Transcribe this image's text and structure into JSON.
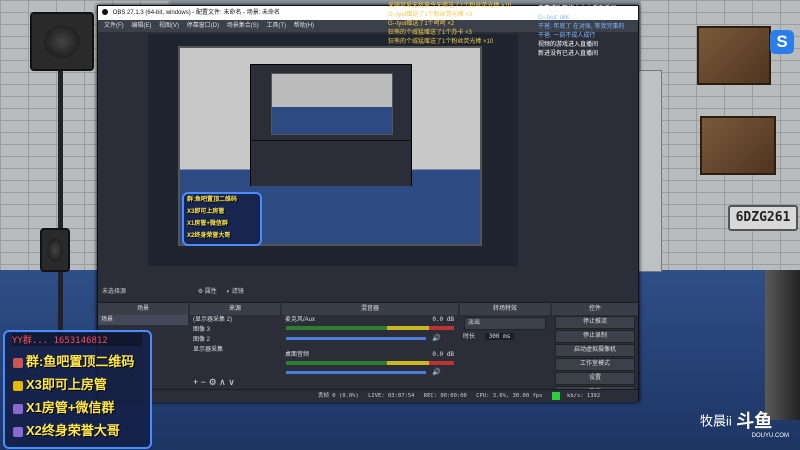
{
  "obs": {
    "title": "OBS 27.1.3 (64-bit, windows) - 配置文件: 未命名 - 场景: 未命名",
    "menu": [
      "文件(F)",
      "编辑(E)",
      "视图(V)",
      "停靠窗口(D)",
      "场景集合(S)",
      "工具(T)",
      "帮助(H)"
    ],
    "preview_label": "未选择源",
    "toolbar": {
      "properties": "属性",
      "filters": "滤镜"
    },
    "docks": {
      "scenes": {
        "title": "场景",
        "items": [
          "场景"
        ]
      },
      "sources": {
        "title": "来源",
        "items": [
          "(显示器采集 2)",
          "图像 3",
          "图像 2",
          "显示器采集"
        ]
      },
      "mixer": {
        "title": "混音器",
        "channels": [
          {
            "name": "麦克风/Aux",
            "level": "0.0 dB"
          },
          {
            "name": "桌面音频",
            "level": "0.0 dB"
          }
        ],
        "ticks": [
          "-60",
          "-55",
          "-50",
          "-45",
          "-40",
          "-35",
          "-30",
          "-25",
          "-20",
          "-15",
          "-10",
          "-5",
          "0"
        ]
      },
      "transitions": {
        "title": "转场特效",
        "type": "淡出",
        "duration_label": "时长",
        "duration_value": "300 ms"
      },
      "controls": {
        "title": "控件",
        "buttons": [
          "停止推流",
          "停止录制",
          "启动虚拟摄像机",
          "工作室模式",
          "设置",
          "退出"
        ]
      }
    },
    "status": {
      "dropped": "丢帧 0 (0.0%)",
      "live": "LIVE: 03:07:54",
      "rec": "REC: 00:00:00",
      "cpu": "CPU: 3.6%, 30.00 fps",
      "bitrate": "kb/s: 1392"
    }
  },
  "chat_left": [
    {
      "text": "呆萌可爱无敌黄今天赠送了1个粉丝荧光棒 ×10",
      "color": "gold"
    },
    {
      "text": "G--tyut赠送了1个粉丝荧光棒 ×3",
      "color": "gold"
    },
    {
      "text": "G--tyut赠送了1个呵呵 ×2",
      "color": "gold"
    },
    {
      "text": "狂熊的个威猛赠送了1个办卡 ×3",
      "color": "gold"
    },
    {
      "text": "狂熊的个威猛赠送了1个粉丝荧光棒 ×10",
      "color": "gold"
    }
  ],
  "chat_right": [
    {
      "text": "恭喜成功签约本大主播直播间",
      "color": "white"
    },
    {
      "text": "G--tyut: okk",
      "color": "blue"
    },
    {
      "text": "干爸: 年底了 在对账, 等我完事的",
      "color": "blue"
    },
    {
      "text": "干爸: 一刻不成人成行",
      "color": "blue"
    },
    {
      "text": "视频的游戏进入直播间",
      "color": "white"
    },
    {
      "text": "新进没有已进入直播间",
      "color": "white"
    }
  ],
  "overlay": {
    "tag": "YY群... 1653146812",
    "lines": [
      "群:鱼吧置顶二维码",
      "X3即可上房管",
      "X1房管+微信群",
      "X2终身荣誉大哥"
    ]
  },
  "scene": {
    "plates": [
      "6DZG261",
      "6DZG261"
    ]
  },
  "watermark": {
    "name": "牧晨ii",
    "brand": "斗鱼",
    "site": "DOUYU.COM"
  },
  "logo_letter": "S",
  "colors": {
    "accent": "#2b7de9",
    "overlay_border": "#4b8cff",
    "gift_text": "#f2c94c"
  }
}
